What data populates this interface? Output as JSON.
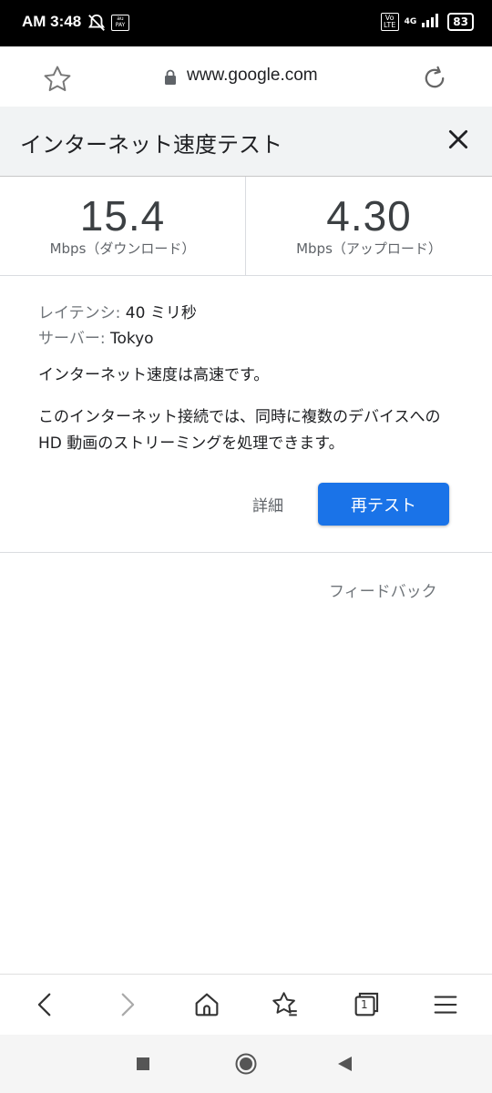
{
  "status_bar": {
    "time": "AM 3:48",
    "network": "4G",
    "volte": "Vo LTE",
    "pay_badge": "au PAY",
    "battery": "83"
  },
  "browser": {
    "url": "www.google.com",
    "tab_count": "1"
  },
  "widget": {
    "title": "インターネット速度テスト",
    "download": {
      "value": "15.4",
      "unit": "Mbps（ダウンロード）"
    },
    "upload": {
      "value": "4.30",
      "unit": "Mbps（アップロード）"
    },
    "latency": {
      "label": "レイテンシ: ",
      "value": "40 ミリ秒"
    },
    "server": {
      "label": "サーバー: ",
      "value": "Tokyo"
    },
    "status": "インターネット速度は高速です。",
    "description": "このインターネット接続では、同時に複数のデバイスへの HD 動画のストリーミングを処理できます。",
    "details_label": "詳細",
    "retest_label": "再テスト",
    "feedback_label": "フィードバック"
  },
  "colors": {
    "accent": "#1a73e8",
    "header_bg": "#f1f3f4"
  },
  "icons": [
    "star-icon",
    "lock-icon",
    "reload-icon",
    "close-icon",
    "back-icon",
    "forward-icon",
    "home-icon",
    "bookmarks-icon",
    "tabs-icon",
    "menu-icon",
    "recent-apps-icon",
    "home-nav-icon",
    "back-nav-icon"
  ]
}
